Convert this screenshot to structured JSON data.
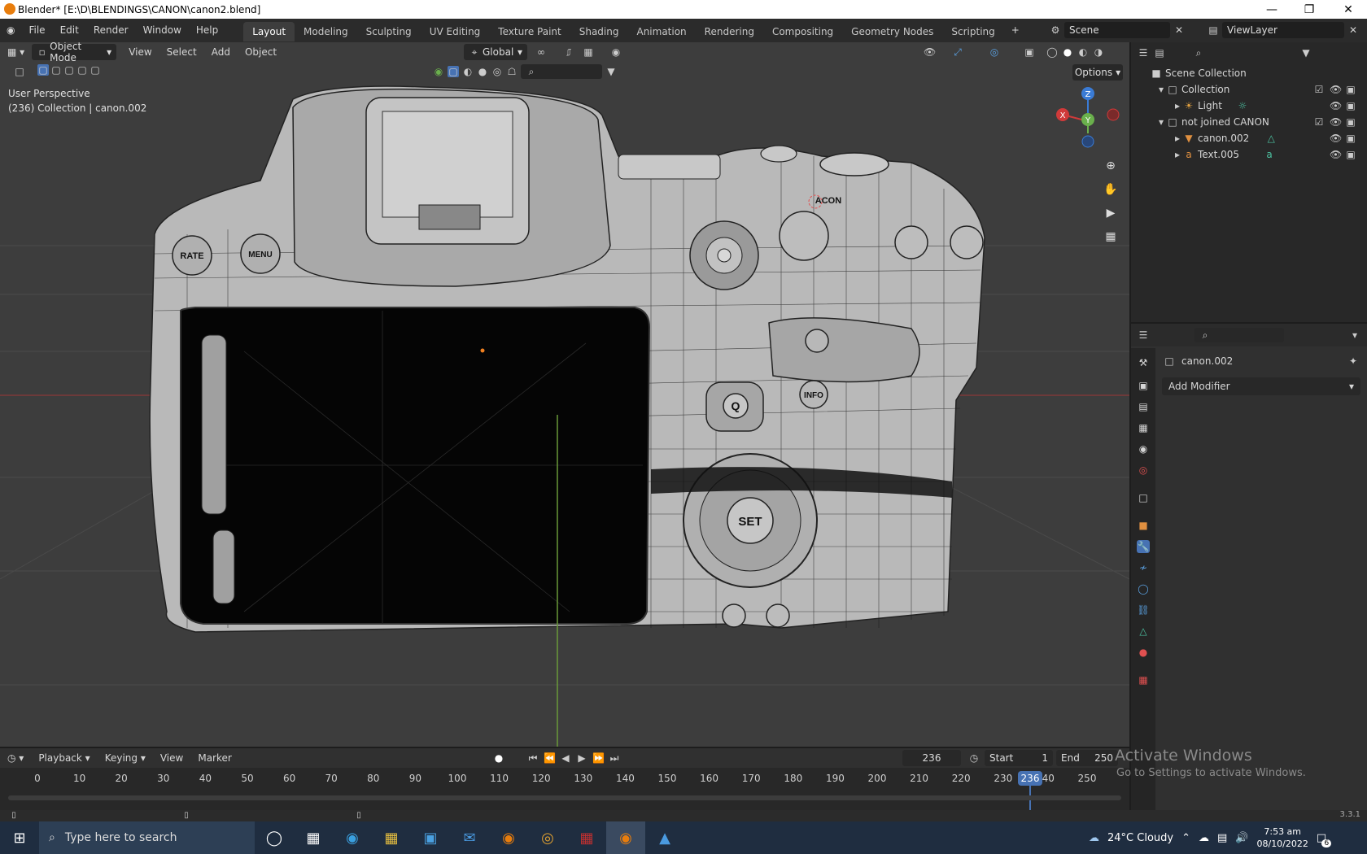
{
  "window": {
    "title": "Blender* [E:\\D\\BLENDINGS\\CANON\\canon2.blend]"
  },
  "menu": {
    "items": [
      "File",
      "Edit",
      "Render",
      "Window",
      "Help"
    ]
  },
  "workspaces": [
    "Layout",
    "Modeling",
    "Sculpting",
    "UV Editing",
    "Texture Paint",
    "Shading",
    "Animation",
    "Rendering",
    "Compositing",
    "Geometry Nodes",
    "Scripting"
  ],
  "scene": {
    "label": "Scene",
    "view_layer": "ViewLayer"
  },
  "viewport": {
    "mode": "Object Mode",
    "menus": [
      "View",
      "Select",
      "Add",
      "Object"
    ],
    "orientation": "Global",
    "options_label": "Options",
    "perspective_label": "User Perspective",
    "collection_label": "(236) Collection | canon.002",
    "gizmo_axes": [
      "X",
      "Y",
      "Z"
    ],
    "model_labels": {
      "rate": "RATE",
      "menu": "MENU",
      "brand": "ACON",
      "q": "Q",
      "info": "INFO",
      "set": "SET"
    }
  },
  "outliner": {
    "rows": [
      {
        "label": "Scene Collection",
        "level": 0
      },
      {
        "label": "Collection",
        "level": 1
      },
      {
        "label": "Light",
        "level": 2
      },
      {
        "label": "not joined CANON",
        "level": 1
      },
      {
        "label": "canon.002",
        "level": 2
      },
      {
        "label": "Text.005",
        "level": 2
      }
    ]
  },
  "properties": {
    "object_name": "canon.002",
    "add_modifier": "Add Modifier"
  },
  "timeline": {
    "menus": [
      "Playback",
      "Keying",
      "View",
      "Marker"
    ],
    "current_frame": "236",
    "start_label": "Start",
    "start": "1",
    "end_label": "End",
    "end": "250",
    "ticks": [
      "0",
      "10",
      "20",
      "30",
      "40",
      "50",
      "60",
      "70",
      "80",
      "90",
      "100",
      "110",
      "120",
      "130",
      "140",
      "150",
      "160",
      "170",
      "180",
      "190",
      "200",
      "210",
      "220",
      "230",
      "240",
      "250"
    ]
  },
  "activation": {
    "title": "Activate Windows",
    "subtitle": "Go to Settings to activate Windows."
  },
  "status": {
    "version": "3.3.1"
  },
  "taskbar": {
    "search_placeholder": "Type here to search",
    "weather": "24°C  Cloudy",
    "time": "7:53 am",
    "date": "08/10/2022",
    "notifications": "6"
  }
}
